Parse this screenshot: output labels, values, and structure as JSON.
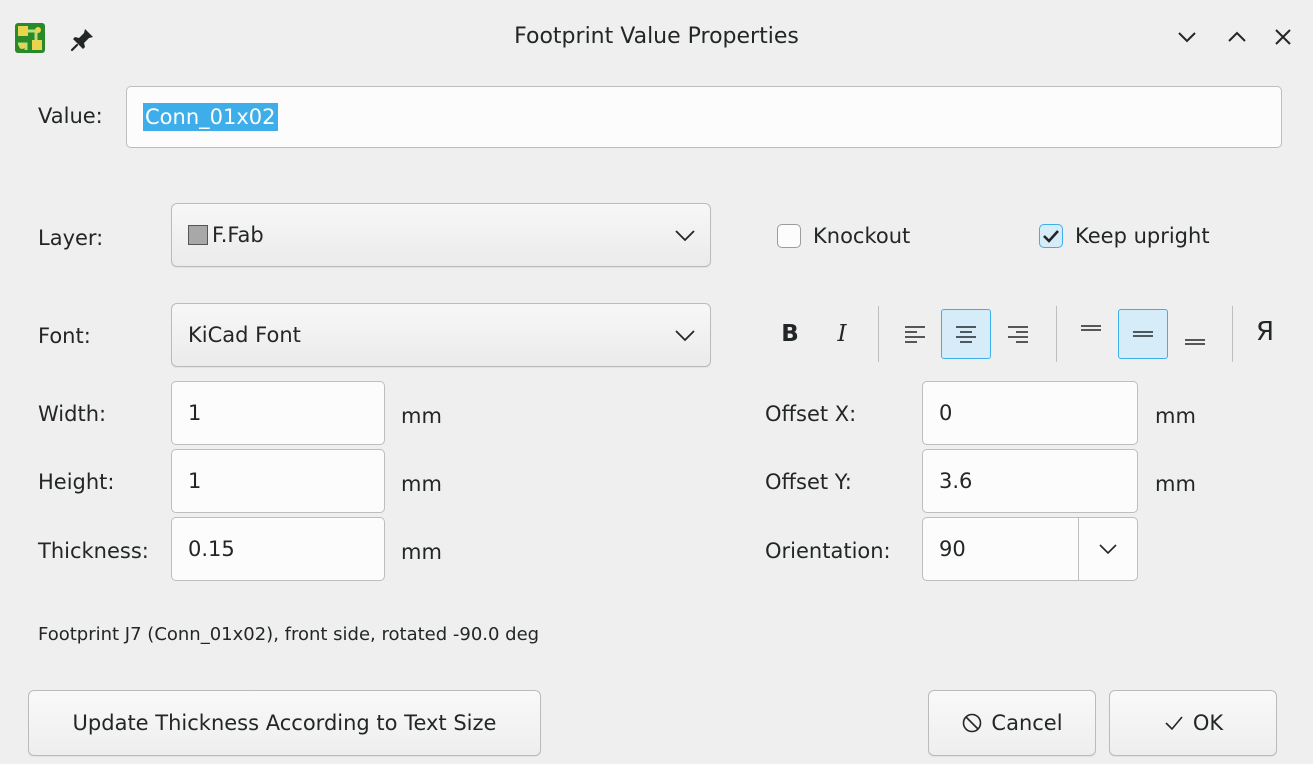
{
  "window": {
    "title": "Footprint Value Properties",
    "icons": {
      "app": "kicad-pcb-icon",
      "pin": "pin-icon",
      "minimize": "chevron-down-icon",
      "maximize": "chevron-up-icon",
      "close": "close-icon"
    }
  },
  "value": {
    "label": "Value:",
    "text": "Conn_01x02",
    "selected": true
  },
  "layer": {
    "label": "Layer:",
    "selected": "F.Fab",
    "swatch_color": "#a8a8a8"
  },
  "checkboxes": {
    "knockout": {
      "label": "Knockout",
      "checked": false
    },
    "keep_upright": {
      "label": "Keep upright",
      "checked": true
    }
  },
  "font": {
    "label": "Font:",
    "selected": "KiCad Font"
  },
  "format_toolbar": {
    "bold": {
      "glyph": "B",
      "icon": "bold-icon"
    },
    "italic": {
      "glyph": "I",
      "icon": "italic-icon"
    },
    "halign": {
      "options": [
        "left",
        "center",
        "right"
      ],
      "selected": "center"
    },
    "valign": {
      "options": [
        "top",
        "center",
        "bottom"
      ],
      "selected": "center"
    },
    "mirror": {
      "glyph": "Я",
      "icon": "mirror-icon"
    }
  },
  "fields": {
    "width": {
      "label": "Width:",
      "value": "1",
      "unit": "mm"
    },
    "height": {
      "label": "Height:",
      "value": "1",
      "unit": "mm"
    },
    "thickness": {
      "label": "Thickness:",
      "value": "0.15",
      "unit": "mm"
    },
    "offset_x": {
      "label": "Offset X:",
      "value": "0",
      "unit": "mm"
    },
    "offset_y": {
      "label": "Offset Y:",
      "value": "3.6",
      "unit": "mm"
    },
    "orientation": {
      "label": "Orientation:",
      "value": "90"
    }
  },
  "status": "Footprint J7 (Conn_01x02), front side, rotated -90.0 deg",
  "buttons": {
    "update_thickness": "Update Thickness According to Text Size",
    "cancel": "Cancel",
    "ok": "OK"
  },
  "colors": {
    "accent": "#3daee9",
    "selection_bg": "#3daee9",
    "background": "#efefef"
  }
}
